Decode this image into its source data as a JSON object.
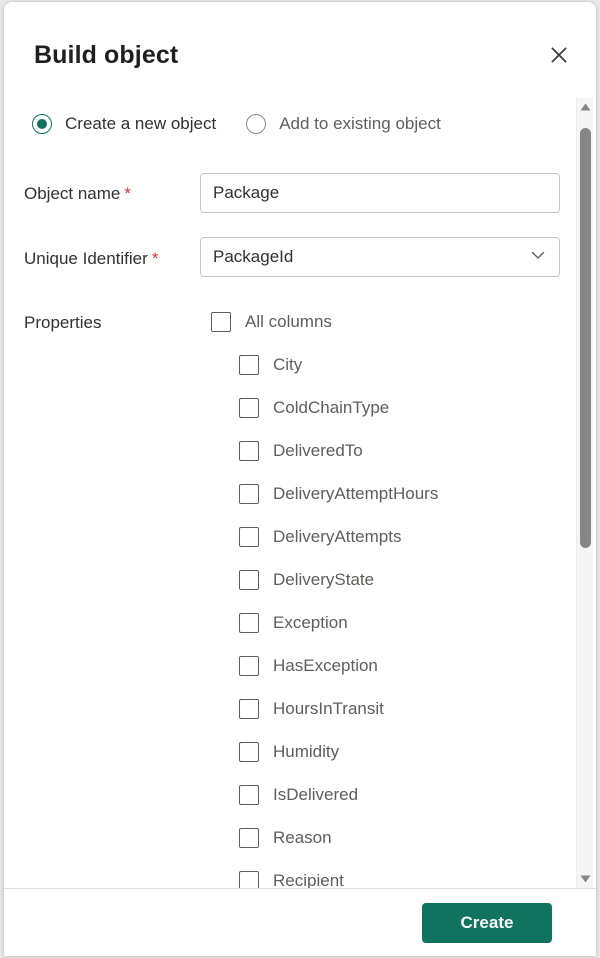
{
  "dialog": {
    "title": "Build object",
    "close_icon": "close-icon",
    "accent_color": "#107360",
    "radio_accent_color": "#10715f",
    "required_color": "#d13438"
  },
  "mode": {
    "options": [
      {
        "label": "Create a new object",
        "selected": true
      },
      {
        "label": "Add to existing object",
        "selected": false
      }
    ]
  },
  "fields": {
    "object_name": {
      "label": "Object name",
      "required_marker": "*",
      "value": "Package",
      "placeholder": "Object name"
    },
    "unique_identifier": {
      "label": "Unique Identifier",
      "required_marker": "*",
      "value": "PackageId",
      "chevron_icon": "chevron-down-icon"
    },
    "properties": {
      "label": "Properties",
      "select_all": {
        "label": "All columns",
        "checked": false
      },
      "items": [
        {
          "label": "City",
          "checked": false
        },
        {
          "label": "ColdChainType",
          "checked": false
        },
        {
          "label": "DeliveredTo",
          "checked": false
        },
        {
          "label": "DeliveryAttemptHours",
          "checked": false
        },
        {
          "label": "DeliveryAttempts",
          "checked": false
        },
        {
          "label": "DeliveryState",
          "checked": false
        },
        {
          "label": "Exception",
          "checked": false
        },
        {
          "label": "HasException",
          "checked": false
        },
        {
          "label": "HoursInTransit",
          "checked": false
        },
        {
          "label": "Humidity",
          "checked": false
        },
        {
          "label": "IsDelivered",
          "checked": false
        },
        {
          "label": "Reason",
          "checked": false
        },
        {
          "label": "Recipient",
          "checked": false
        }
      ]
    }
  },
  "scrollbar": {
    "up_arrow_icon": "triangle-up-icon",
    "down_arrow_icon": "triangle-down-icon"
  },
  "footer": {
    "create_label": "Create"
  }
}
